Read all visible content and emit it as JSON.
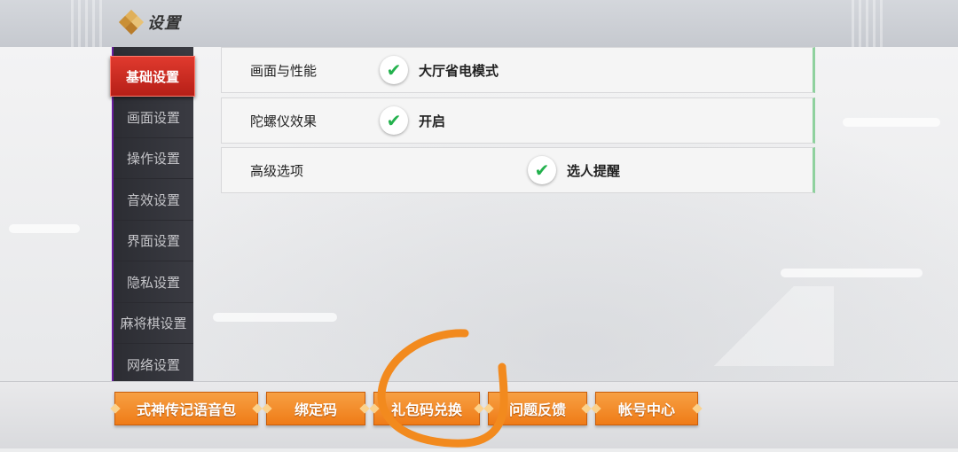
{
  "header": {
    "title": "设置"
  },
  "sidebar": {
    "items": [
      {
        "label": "基础设置",
        "active": true
      },
      {
        "label": "画面设置"
      },
      {
        "label": "操作设置"
      },
      {
        "label": "音效设置"
      },
      {
        "label": "界面设置"
      },
      {
        "label": "隐私设置"
      },
      {
        "label": "麻将棋设置"
      },
      {
        "label": "网络设置"
      }
    ]
  },
  "settings": {
    "rows": [
      {
        "label": "画面与性能",
        "option": "大厅省电模式",
        "checked": true
      },
      {
        "label": "陀螺仪效果",
        "option": "开启",
        "checked": true
      },
      {
        "label": "高级选项",
        "option": "选人提醒",
        "checked": true
      }
    ]
  },
  "footer": {
    "buttons": [
      {
        "label": "式神传记语音包"
      },
      {
        "label": "绑定码"
      },
      {
        "label": "礼包码兑换"
      },
      {
        "label": "问题反馈"
      },
      {
        "label": "帐号中心"
      }
    ]
  },
  "colors": {
    "accent_red": "#d12d22",
    "button_orange": "#f08a2a",
    "check_green": "#23b14d",
    "annotation_orange": "#f28a1e"
  },
  "icons": {
    "title": "diamond-settings-icon",
    "check": "checkmark-icon"
  }
}
